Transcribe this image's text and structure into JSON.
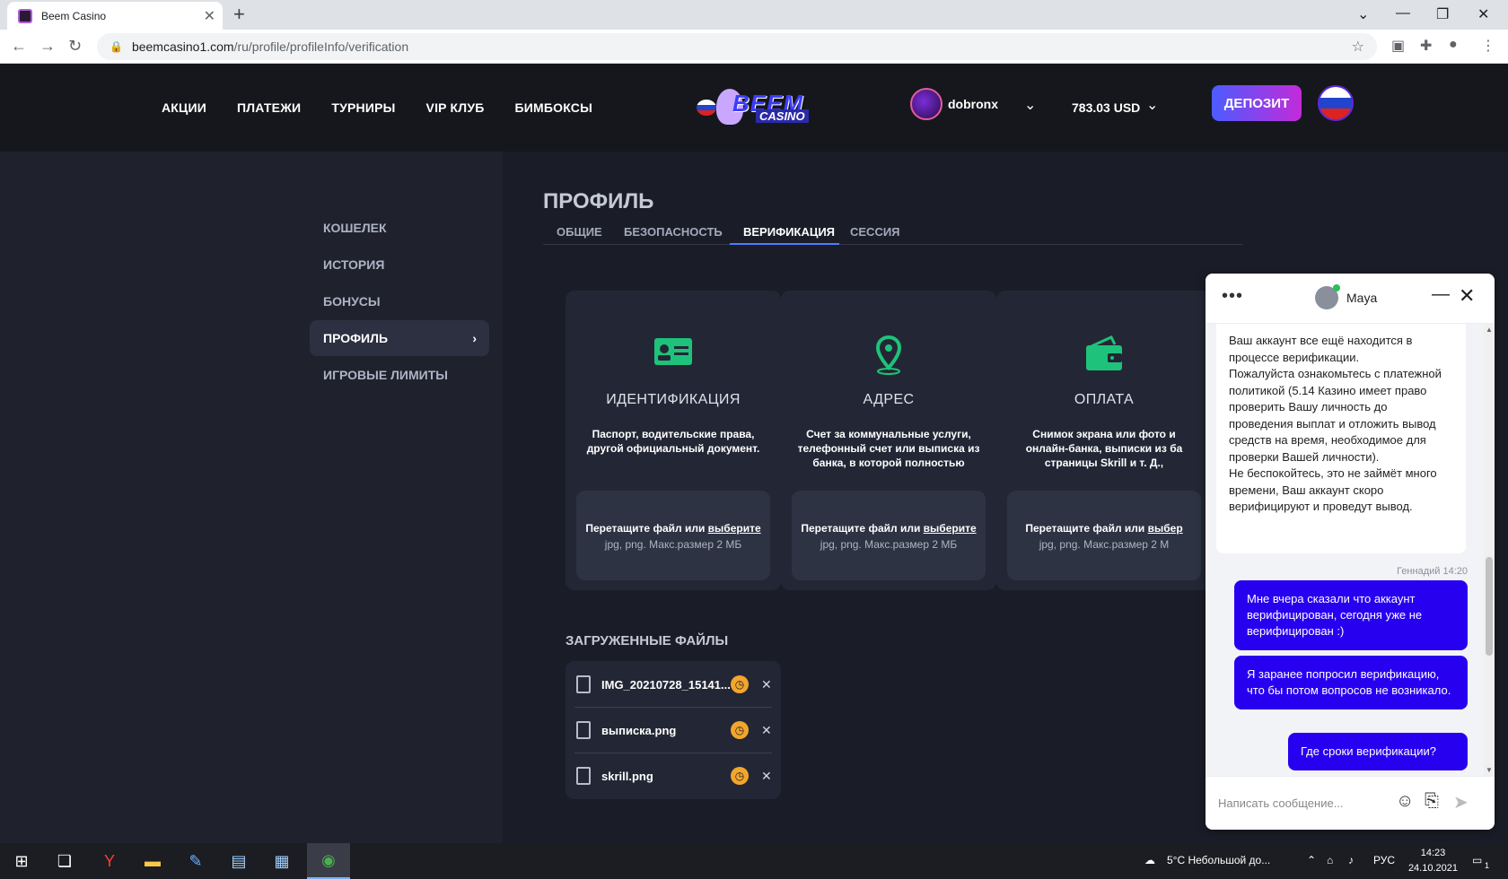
{
  "browser": {
    "tab_title": "Beem Casino",
    "url_host": "beemcasino1.com",
    "url_path": "/ru/profile/profileInfo/verification"
  },
  "header": {
    "nav": [
      "АКЦИИ",
      "ПЛАТЕЖИ",
      "ТУРНИРЫ",
      "VIP КЛУБ",
      "БИМБОКСЫ"
    ],
    "logo_top": "BEEM",
    "logo_bottom": "CASINO",
    "username": "dobronx",
    "balance": "783.03 USD",
    "deposit_label": "ДЕПОЗИТ"
  },
  "sidebar": {
    "items": [
      {
        "label": "КОШЕЛЕК"
      },
      {
        "label": "ИСТОРИЯ"
      },
      {
        "label": "БОНУСЫ"
      },
      {
        "label": "ПРОФИЛЬ",
        "active": true
      },
      {
        "label": "ИГРОВЫЕ ЛИМИТЫ"
      }
    ]
  },
  "profile": {
    "title": "ПРОФИЛЬ",
    "tabs": [
      {
        "label": "ОБЩИЕ"
      },
      {
        "label": "БЕЗОПАСНОСТЬ"
      },
      {
        "label": "ВЕРИФИКАЦИЯ",
        "active": true
      },
      {
        "label": "СЕССИЯ"
      }
    ],
    "cards": [
      {
        "icon": "id-card-icon",
        "title": "ИДЕНТИФИКАЦИЯ",
        "desc": "Паспорт, водительские права,\nдругой официальный документ.",
        "drop_text": "Перетащите файл или ",
        "drop_link": "выберите",
        "drop_hint": "jpg, png. Макс.размер 2 МБ"
      },
      {
        "icon": "location-pin-icon",
        "title": "АДРЕС",
        "desc": "Счет за коммунальные услуги,\nтелефонный счет или выписка из\nбанка, в которой полностью",
        "drop_text": "Перетащите файл или ",
        "drop_link": "выберите",
        "drop_hint": "jpg, png. Макс.размер 2 МБ"
      },
      {
        "icon": "wallet-icon",
        "title": "ОПЛАТА",
        "desc": "Снимок экрана или фото и\nонлайн-банка, выписки из ба\nстраницы Skrill и т. Д.,",
        "drop_text": "Перетащите файл или ",
        "drop_link": "выбер",
        "drop_hint": "jpg, png. Макс.размер 2 М"
      }
    ],
    "uploaded_title": "ЗАГРУЖЕННЫЕ ФАЙЛЫ",
    "files": [
      {
        "name": "IMG_20210728_15141..."
      },
      {
        "name": "выписка.png"
      },
      {
        "name": "skrill.png"
      }
    ]
  },
  "chat": {
    "agent_name": "Maya",
    "agent_message": "Ваш аккаунт все ещё находится в процессе верификации.\nПожалуйста ознакомьтесь с платежной политикой (5.14 Казино имеет право проверить Вашу личность до проведения выплат и отложить вывод средств на время, необходимое для проверки Вашей личности).\nНе беспокойтесь, это не займёт много времени, Ваш аккаунт скоро верифицируют и проведут вывод.",
    "user_meta": "Геннадий 14:20",
    "user_messages": [
      "Мне вчера сказали что аккаунт верифицирован, сегодня уже не верифицирован :)",
      "Я заранее попросил верификацию, что бы потом вопросов не возникало.",
      "Где сроки верификации?"
    ],
    "input_placeholder": "Написать сообщение..."
  },
  "taskbar": {
    "weather": "5°C  Небольшой до...",
    "lang": "РУС",
    "time": "14:23",
    "date": "24.10.2021",
    "notif_count": "1"
  }
}
